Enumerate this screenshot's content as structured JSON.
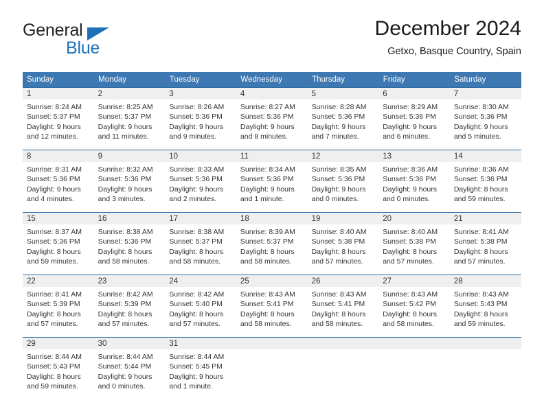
{
  "brand": {
    "name_part1": "General",
    "name_part2": "Blue",
    "accent_color": "#1d71b8"
  },
  "header": {
    "month_title": "December 2024",
    "location": "Getxo, Basque Country, Spain"
  },
  "theme": {
    "header_row_bg": "#3d78b2",
    "daynum_bg": "#efefef",
    "rule_color": "#2e6da4",
    "text_color": "#333333"
  },
  "weekday_headers": [
    "Sunday",
    "Monday",
    "Tuesday",
    "Wednesday",
    "Thursday",
    "Friday",
    "Saturday"
  ],
  "weeks": [
    [
      {
        "day": "1",
        "sunrise": "Sunrise: 8:24 AM",
        "sunset": "Sunset: 5:37 PM",
        "daylight_line1": "Daylight: 9 hours",
        "daylight_line2": "and 12 minutes."
      },
      {
        "day": "2",
        "sunrise": "Sunrise: 8:25 AM",
        "sunset": "Sunset: 5:37 PM",
        "daylight_line1": "Daylight: 9 hours",
        "daylight_line2": "and 11 minutes."
      },
      {
        "day": "3",
        "sunrise": "Sunrise: 8:26 AM",
        "sunset": "Sunset: 5:36 PM",
        "daylight_line1": "Daylight: 9 hours",
        "daylight_line2": "and 9 minutes."
      },
      {
        "day": "4",
        "sunrise": "Sunrise: 8:27 AM",
        "sunset": "Sunset: 5:36 PM",
        "daylight_line1": "Daylight: 9 hours",
        "daylight_line2": "and 8 minutes."
      },
      {
        "day": "5",
        "sunrise": "Sunrise: 8:28 AM",
        "sunset": "Sunset: 5:36 PM",
        "daylight_line1": "Daylight: 9 hours",
        "daylight_line2": "and 7 minutes."
      },
      {
        "day": "6",
        "sunrise": "Sunrise: 8:29 AM",
        "sunset": "Sunset: 5:36 PM",
        "daylight_line1": "Daylight: 9 hours",
        "daylight_line2": "and 6 minutes."
      },
      {
        "day": "7",
        "sunrise": "Sunrise: 8:30 AM",
        "sunset": "Sunset: 5:36 PM",
        "daylight_line1": "Daylight: 9 hours",
        "daylight_line2": "and 5 minutes."
      }
    ],
    [
      {
        "day": "8",
        "sunrise": "Sunrise: 8:31 AM",
        "sunset": "Sunset: 5:36 PM",
        "daylight_line1": "Daylight: 9 hours",
        "daylight_line2": "and 4 minutes."
      },
      {
        "day": "9",
        "sunrise": "Sunrise: 8:32 AM",
        "sunset": "Sunset: 5:36 PM",
        "daylight_line1": "Daylight: 9 hours",
        "daylight_line2": "and 3 minutes."
      },
      {
        "day": "10",
        "sunrise": "Sunrise: 8:33 AM",
        "sunset": "Sunset: 5:36 PM",
        "daylight_line1": "Daylight: 9 hours",
        "daylight_line2": "and 2 minutes."
      },
      {
        "day": "11",
        "sunrise": "Sunrise: 8:34 AM",
        "sunset": "Sunset: 5:36 PM",
        "daylight_line1": "Daylight: 9 hours",
        "daylight_line2": "and 1 minute."
      },
      {
        "day": "12",
        "sunrise": "Sunrise: 8:35 AM",
        "sunset": "Sunset: 5:36 PM",
        "daylight_line1": "Daylight: 9 hours",
        "daylight_line2": "and 0 minutes."
      },
      {
        "day": "13",
        "sunrise": "Sunrise: 8:36 AM",
        "sunset": "Sunset: 5:36 PM",
        "daylight_line1": "Daylight: 9 hours",
        "daylight_line2": "and 0 minutes."
      },
      {
        "day": "14",
        "sunrise": "Sunrise: 8:36 AM",
        "sunset": "Sunset: 5:36 PM",
        "daylight_line1": "Daylight: 8 hours",
        "daylight_line2": "and 59 minutes."
      }
    ],
    [
      {
        "day": "15",
        "sunrise": "Sunrise: 8:37 AM",
        "sunset": "Sunset: 5:36 PM",
        "daylight_line1": "Daylight: 8 hours",
        "daylight_line2": "and 59 minutes."
      },
      {
        "day": "16",
        "sunrise": "Sunrise: 8:38 AM",
        "sunset": "Sunset: 5:36 PM",
        "daylight_line1": "Daylight: 8 hours",
        "daylight_line2": "and 58 minutes."
      },
      {
        "day": "17",
        "sunrise": "Sunrise: 8:38 AM",
        "sunset": "Sunset: 5:37 PM",
        "daylight_line1": "Daylight: 8 hours",
        "daylight_line2": "and 58 minutes."
      },
      {
        "day": "18",
        "sunrise": "Sunrise: 8:39 AM",
        "sunset": "Sunset: 5:37 PM",
        "daylight_line1": "Daylight: 8 hours",
        "daylight_line2": "and 58 minutes."
      },
      {
        "day": "19",
        "sunrise": "Sunrise: 8:40 AM",
        "sunset": "Sunset: 5:38 PM",
        "daylight_line1": "Daylight: 8 hours",
        "daylight_line2": "and 57 minutes."
      },
      {
        "day": "20",
        "sunrise": "Sunrise: 8:40 AM",
        "sunset": "Sunset: 5:38 PM",
        "daylight_line1": "Daylight: 8 hours",
        "daylight_line2": "and 57 minutes."
      },
      {
        "day": "21",
        "sunrise": "Sunrise: 8:41 AM",
        "sunset": "Sunset: 5:38 PM",
        "daylight_line1": "Daylight: 8 hours",
        "daylight_line2": "and 57 minutes."
      }
    ],
    [
      {
        "day": "22",
        "sunrise": "Sunrise: 8:41 AM",
        "sunset": "Sunset: 5:39 PM",
        "daylight_line1": "Daylight: 8 hours",
        "daylight_line2": "and 57 minutes."
      },
      {
        "day": "23",
        "sunrise": "Sunrise: 8:42 AM",
        "sunset": "Sunset: 5:39 PM",
        "daylight_line1": "Daylight: 8 hours",
        "daylight_line2": "and 57 minutes."
      },
      {
        "day": "24",
        "sunrise": "Sunrise: 8:42 AM",
        "sunset": "Sunset: 5:40 PM",
        "daylight_line1": "Daylight: 8 hours",
        "daylight_line2": "and 57 minutes."
      },
      {
        "day": "25",
        "sunrise": "Sunrise: 8:43 AM",
        "sunset": "Sunset: 5:41 PM",
        "daylight_line1": "Daylight: 8 hours",
        "daylight_line2": "and 58 minutes."
      },
      {
        "day": "26",
        "sunrise": "Sunrise: 8:43 AM",
        "sunset": "Sunset: 5:41 PM",
        "daylight_line1": "Daylight: 8 hours",
        "daylight_line2": "and 58 minutes."
      },
      {
        "day": "27",
        "sunrise": "Sunrise: 8:43 AM",
        "sunset": "Sunset: 5:42 PM",
        "daylight_line1": "Daylight: 8 hours",
        "daylight_line2": "and 58 minutes."
      },
      {
        "day": "28",
        "sunrise": "Sunrise: 8:43 AM",
        "sunset": "Sunset: 5:43 PM",
        "daylight_line1": "Daylight: 8 hours",
        "daylight_line2": "and 59 minutes."
      }
    ],
    [
      {
        "day": "29",
        "sunrise": "Sunrise: 8:44 AM",
        "sunset": "Sunset: 5:43 PM",
        "daylight_line1": "Daylight: 8 hours",
        "daylight_line2": "and 59 minutes."
      },
      {
        "day": "30",
        "sunrise": "Sunrise: 8:44 AM",
        "sunset": "Sunset: 5:44 PM",
        "daylight_line1": "Daylight: 9 hours",
        "daylight_line2": "and 0 minutes."
      },
      {
        "day": "31",
        "sunrise": "Sunrise: 8:44 AM",
        "sunset": "Sunset: 5:45 PM",
        "daylight_line1": "Daylight: 9 hours",
        "daylight_line2": "and 1 minute."
      },
      {
        "day": "",
        "sunrise": "",
        "sunset": "",
        "daylight_line1": "",
        "daylight_line2": ""
      },
      {
        "day": "",
        "sunrise": "",
        "sunset": "",
        "daylight_line1": "",
        "daylight_line2": ""
      },
      {
        "day": "",
        "sunrise": "",
        "sunset": "",
        "daylight_line1": "",
        "daylight_line2": ""
      },
      {
        "day": "",
        "sunrise": "",
        "sunset": "",
        "daylight_line1": "",
        "daylight_line2": ""
      }
    ]
  ]
}
